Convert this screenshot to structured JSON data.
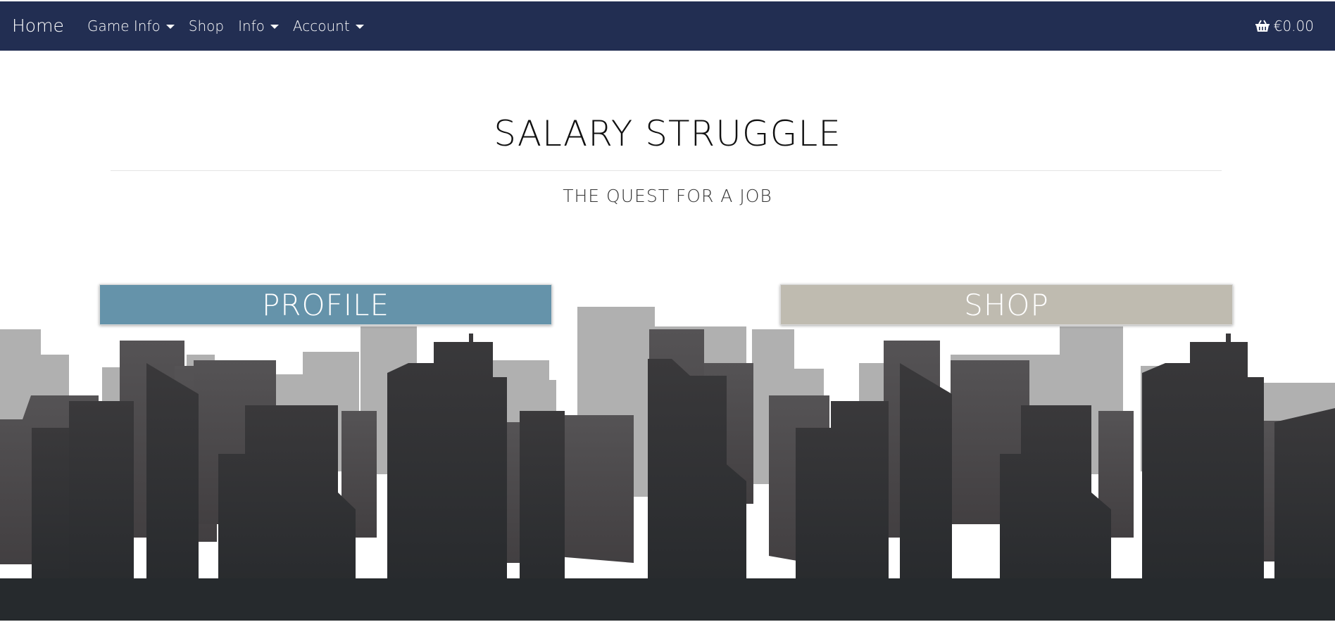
{
  "nav": {
    "brand": "Home",
    "items": [
      {
        "label": "Game Info",
        "dropdown": true
      },
      {
        "label": "Shop",
        "dropdown": false
      },
      {
        "label": "Info",
        "dropdown": true
      },
      {
        "label": "Account",
        "dropdown": true
      }
    ],
    "cart_total": "€0.00",
    "cart_icon": "basket-icon"
  },
  "hero": {
    "title": "SALARY STRUGGLE",
    "subtitle": "THE QUEST FOR A JOB"
  },
  "buttons": {
    "profile_label": "PROFILE",
    "shop_label": "SHOP"
  },
  "colors": {
    "navbar": "#222e52",
    "profile_button": "#6593aa",
    "shop_button": "#bfbbb0",
    "skyline_far": "#b0b0b0",
    "skyline_mid": "#4e4c4e",
    "skyline_near": "#343537",
    "ground": "#262a2d"
  }
}
